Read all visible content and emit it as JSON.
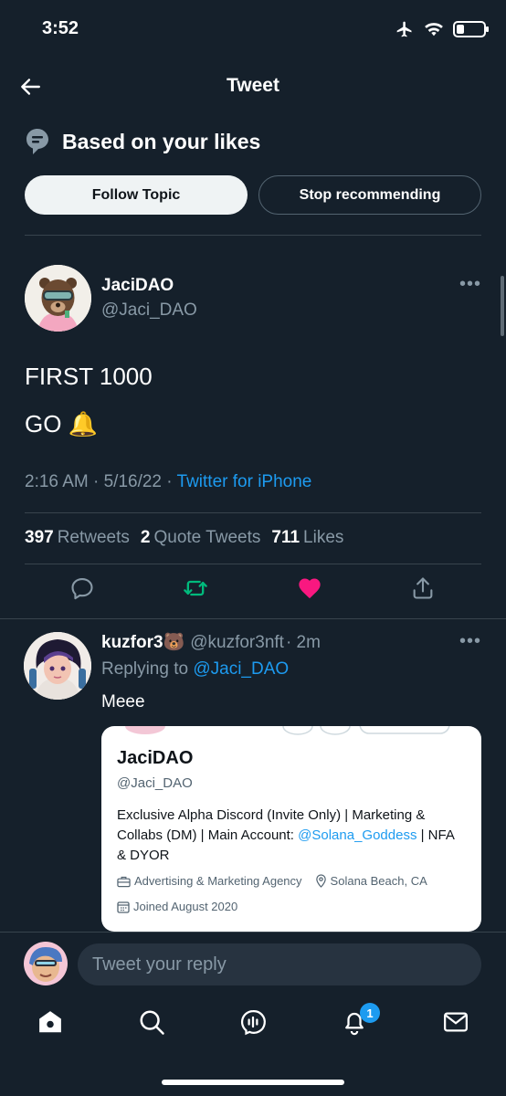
{
  "status_bar": {
    "time": "3:52",
    "battery_level": 0.3
  },
  "header": {
    "title": "Tweet"
  },
  "topic": {
    "title": "Based on your likes",
    "follow_label": "Follow Topic",
    "stop_label": "Stop recommending"
  },
  "tweet": {
    "author_name": "JaciDAO",
    "author_handle": "@Jaci_DAO",
    "text_line1": "FIRST 1000",
    "text_line2": "GO 🔔",
    "time": "2:16 AM · 5/16/22 · ",
    "source": "Twitter for iPhone",
    "retweets_count": "397",
    "retweets_label": "Retweets",
    "quotes_count": "2",
    "quotes_label": "Quote Tweets",
    "likes_count": "711",
    "likes_label": "Likes"
  },
  "reply": {
    "name": "kuzfor3🐻",
    "handle": "@kuzfor3nft",
    "time": "· 2m",
    "replying_to_label": "Replying to ",
    "replying_to_handle": "@Jaci_DAO",
    "text": "Meee"
  },
  "card": {
    "name": "JaciDAO",
    "handle": "@Jaci_DAO",
    "bio_part1": "Exclusive Alpha Discord (Invite Only) | Marketing & Collabs (DM) | Main Account: ",
    "bio_mention": "@Solana_Goddess",
    "bio_part2": " | NFA & DYOR",
    "category": "Advertising & Marketing Agency",
    "location": "Solana Beach, CA",
    "joined": "Joined August 2020"
  },
  "reply_bar": {
    "placeholder": "Tweet your reply"
  },
  "tabbar": {
    "notifications_badge": "1"
  },
  "colors": {
    "background": "#15202b",
    "accent": "#1d9bf0",
    "retweet": "#00ba7c",
    "like": "#f91880"
  }
}
